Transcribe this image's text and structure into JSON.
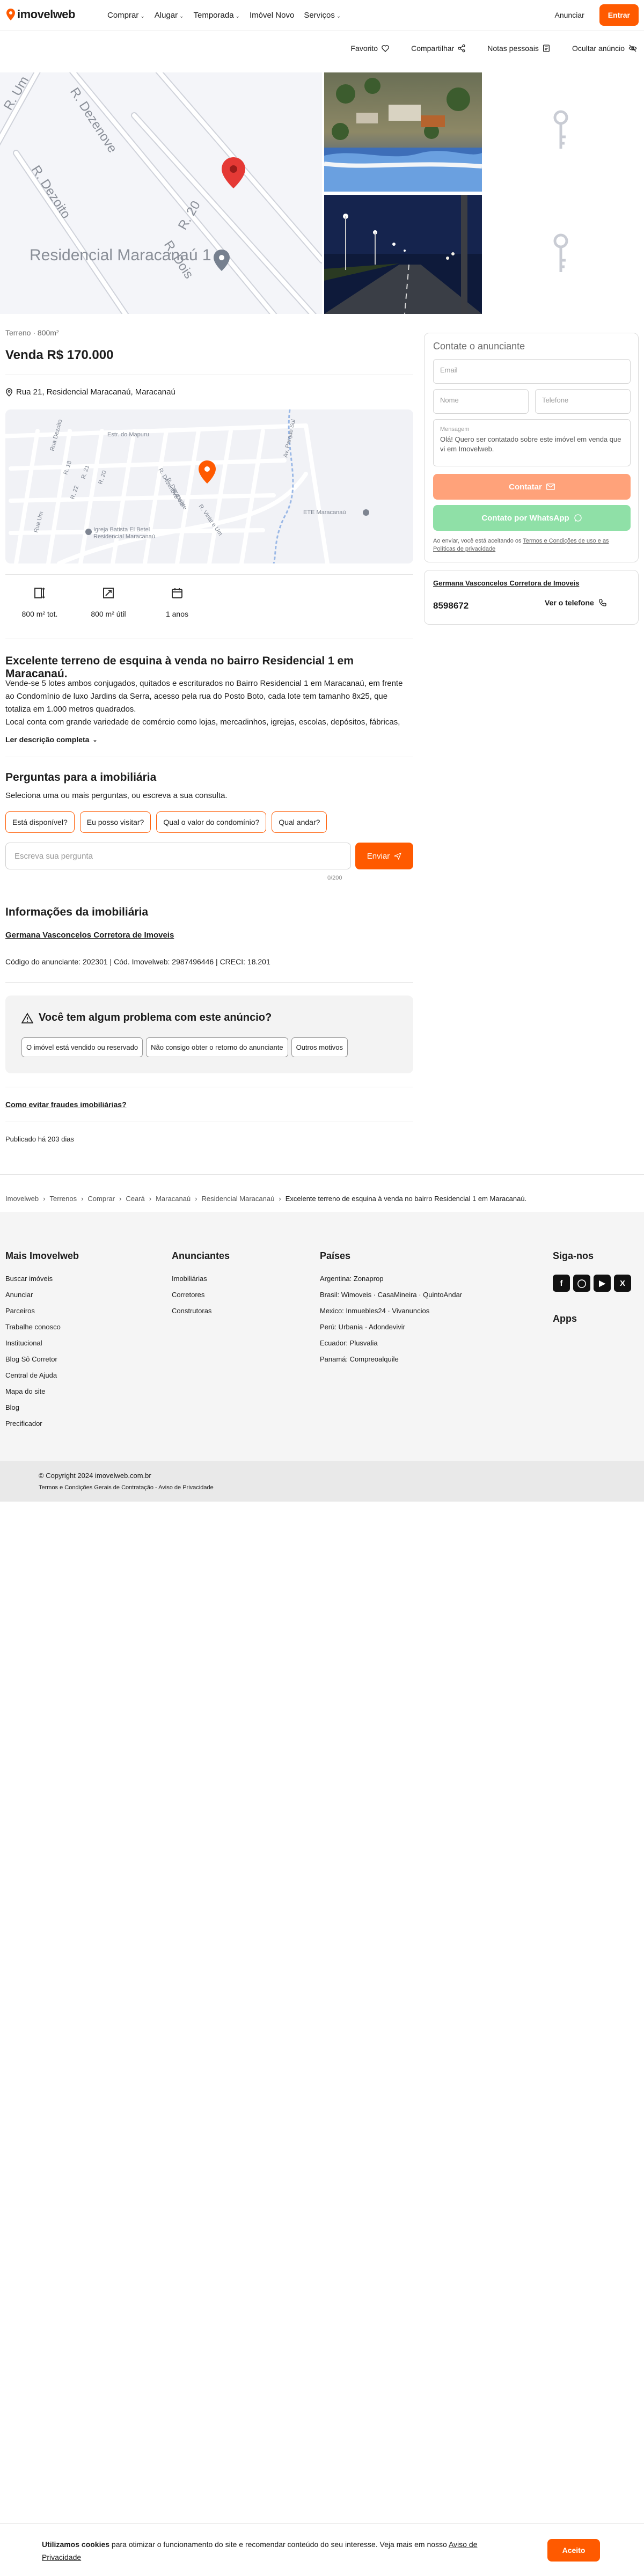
{
  "header": {
    "logo_text": "imovelweb",
    "nav": [
      "Comprar",
      "Alugar",
      "Temporada",
      "Imóvel Novo",
      "Serviços"
    ],
    "nav_has_chevron": [
      true,
      true,
      true,
      false,
      true
    ],
    "announce": "Anunciar",
    "login": "Entrar"
  },
  "actions": {
    "favorite": "Favorito",
    "share": "Compartilhar",
    "notes": "Notas pessoais",
    "hide": "Ocultar anúncio"
  },
  "gallery": {
    "streets": [
      "R. Um",
      "R. Dezenove",
      "R. Dezoito",
      "R. 20",
      "R. Dois"
    ],
    "place": "Residencial Maracanaú 1"
  },
  "listing": {
    "type_area": "Terreno · 800m²",
    "price": "Venda R$ 170.000",
    "address": "Rua 21, Residencial Maracanaú, Maracanaú"
  },
  "minimap": {
    "labels": [
      "Rua Dezoito",
      "Estr. do Mapuru",
      "R. 20",
      "R. 21",
      "R. Dezenove",
      "R. Dezessete",
      "R. Dois",
      "R. 22",
      "R. 18",
      "Rua Um",
      "Av. Parque Sul",
      "R. Vinte e Um",
      "ETE Maracanaú",
      "Igreja Batista El Betel Residencial Maracanaú"
    ]
  },
  "features": [
    {
      "icon": "total-area-icon",
      "label": "800 m² tot."
    },
    {
      "icon": "usable-area-icon",
      "label": "800 m² útil"
    },
    {
      "icon": "calendar-icon",
      "label": "1 anos"
    }
  ],
  "description": {
    "title": "Excelente terreno de esquina à venda no bairro Residencial 1 em Maracanaú.",
    "p1": "Vende-se 5 lotes ambos conjugados, quitados e escriturados no Bairro Residencial 1 em Maracanaú, em frente ao Condomínio de luxo Jardins da Serra, acesso pela rua do Posto Boto, cada lote tem tamanho 8x25, que totaliza em 1.000 metros quadrados.",
    "p2": "Local conta com grande variedade de comércio como lojas, mercadinhos, igrejas, escolas, depósitos, fábricas,",
    "more": "Ler descrição completa"
  },
  "questions": {
    "title": "Perguntas para a imobiliária",
    "subtitle": "Seleciona uma ou mais perguntas, ou escreva a sua consulta.",
    "chips": [
      "Está disponível?",
      "Eu posso visitar?",
      "Qual o valor do condomínio?",
      "Qual andar?"
    ],
    "placeholder": "Escreva sua pergunta",
    "counter": "0/200",
    "send": "Enviar"
  },
  "agency": {
    "title": "Informações da imobiliária",
    "name": "Germana Vasconcelos Corretora de Imoveis",
    "codes": "Código do anunciante: 202301 | Cód. Imovelweb: 2987496446 | CRECI: 18.201"
  },
  "problem": {
    "title": "Você tem algum problema com este anúncio?",
    "options": [
      "O imóvel está vendido ou reservado",
      "Não consigo obter o retorno do anunciante",
      "Outros motivos"
    ]
  },
  "fraud_link": "Como evitar fraudes imobiliárias?",
  "published": "Publicado há 203 dias",
  "contact": {
    "title": "Contate o anunciante",
    "email": "Email",
    "name": "Nome",
    "phone": "Telefone",
    "message_label": "Mensagem",
    "message": "Olá! Quero ser contatado sobre este imóvel em venda que vi em Imovelweb.",
    "btn_contact": "Contatar",
    "btn_whatsapp": "Contato por WhatsApp",
    "terms_prefix": "Ao enviar, você está aceitando os ",
    "terms_link": "Termos e Condições de uso e as Políticas de privacidade"
  },
  "agency_card": {
    "name": "Germana Vasconcelos Corretora de Imoveis",
    "code": "8598672",
    "phone_btn": "Ver o telefone"
  },
  "breadcrumb": [
    "Imovelweb",
    "Terrenos",
    "Comprar",
    "Ceará",
    "Maracanaú",
    "Residencial Maracanaú",
    "Excelente terreno de esquina à venda no bairro Residencial 1 em Maracanaú."
  ],
  "footer": {
    "col1_title": "Mais Imovelweb",
    "col1": [
      "Buscar imóveis",
      "Anunciar",
      "Parceiros",
      "Trabalhe conosco",
      "Institucional",
      "Blog Sô Corretor",
      "Central de Ajuda",
      "Mapa do site",
      "Blog",
      "Precificador"
    ],
    "col2_title": "Anunciantes",
    "col2": [
      "Imobiliárias",
      "Corretores",
      "Construtoras"
    ],
    "col3_title": "Países",
    "col3": [
      "Argentina: Zonaprop",
      "Brasil: Wimoveis · CasaMineira · QuintoAndar",
      "Mexico: Inmuebles24 · Vivanuncios",
      "Perú: Urbania · Adondevivir",
      "Ecuador: Plusvalia",
      "Panamá: Compreoalquile"
    ],
    "social_title": "Siga-nos",
    "apps_title": "Apps",
    "copyright": "© Copyright 2024 imovelweb.com.br",
    "terms": "Termos e Condições Gerais de Contratação - Aviso de Privacidade"
  },
  "cookie": {
    "bold": "Utilizamos cookies",
    "text": " para otimizar o funcionamento do site e recomendar conteúdo do seu interesse. Veja mais em nosso ",
    "link": "Aviso de Privacidade",
    "accept": "Aceito"
  },
  "colors": {
    "brand": "#ff5a00",
    "whatsapp_disabled": "#8fe0a7",
    "contact_disabled": "#ffa27a"
  }
}
